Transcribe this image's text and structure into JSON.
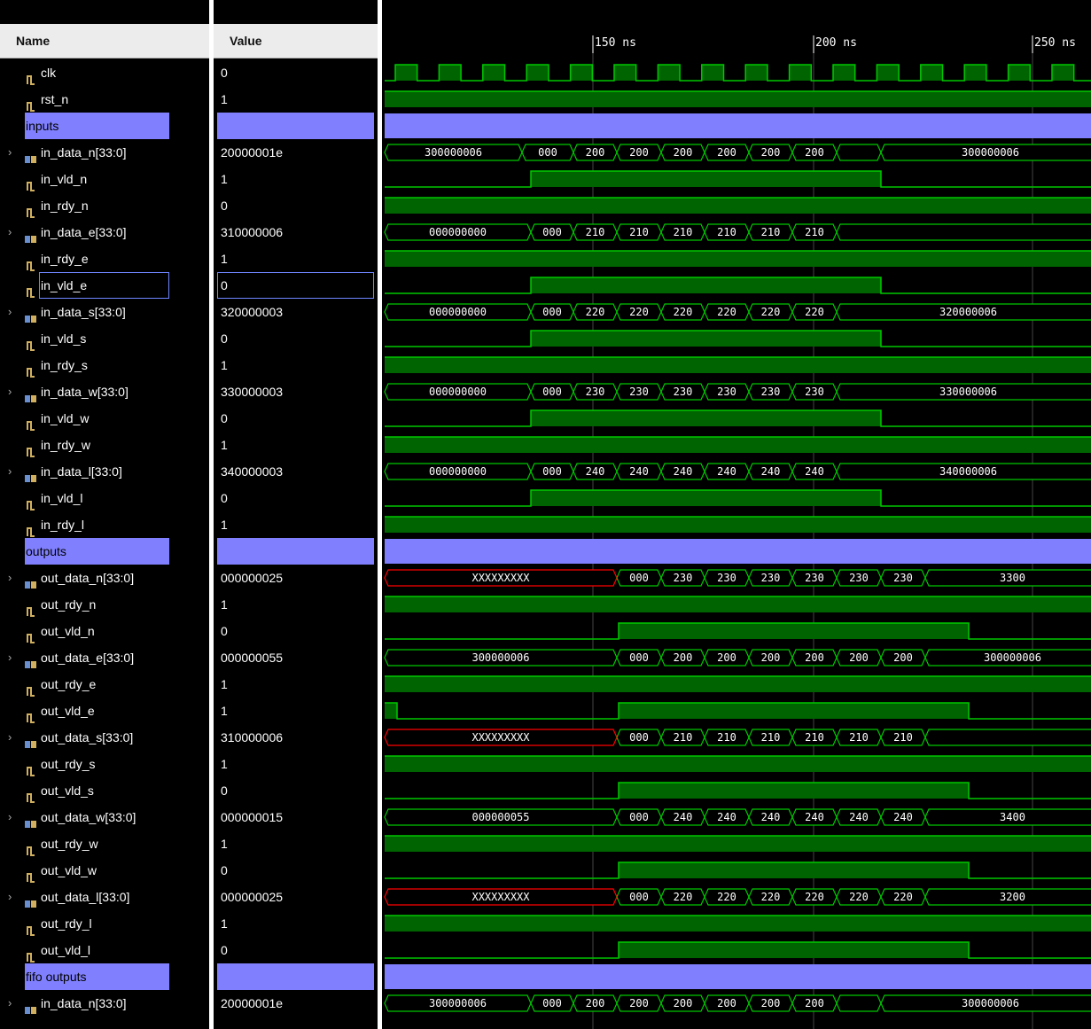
{
  "headers": {
    "name": "Name",
    "value": "Value"
  },
  "timeline": {
    "ticks": [
      "150 ns",
      "200 ns",
      "250 ns"
    ]
  },
  "colors": {
    "wave": "#00c800",
    "wave_fill": "#006400",
    "group": "#8080ff",
    "x_state": "#ff0000"
  },
  "signals": [
    {
      "type": "bit",
      "name": "clk",
      "value": "0"
    },
    {
      "type": "bit",
      "name": "rst_n",
      "value": "1"
    },
    {
      "type": "group",
      "name": "inputs",
      "value": ""
    },
    {
      "type": "bus",
      "name": "in_data_n[33:0]",
      "value": "20000001e"
    },
    {
      "type": "bit",
      "name": "in_vld_n",
      "value": "1"
    },
    {
      "type": "bit",
      "name": "in_rdy_n",
      "value": "0"
    },
    {
      "type": "bus",
      "name": "in_data_e[33:0]",
      "value": "310000006"
    },
    {
      "type": "bit",
      "name": "in_rdy_e",
      "value": "1"
    },
    {
      "type": "bit",
      "name": "in_vld_e",
      "value": "0",
      "selected": true
    },
    {
      "type": "bus",
      "name": "in_data_s[33:0]",
      "value": "320000003"
    },
    {
      "type": "bit",
      "name": "in_vld_s",
      "value": "0"
    },
    {
      "type": "bit",
      "name": "in_rdy_s",
      "value": "1"
    },
    {
      "type": "bus",
      "name": "in_data_w[33:0]",
      "value": "330000003"
    },
    {
      "type": "bit",
      "name": "in_vld_w",
      "value": "0"
    },
    {
      "type": "bit",
      "name": "in_rdy_w",
      "value": "1"
    },
    {
      "type": "bus",
      "name": "in_data_l[33:0]",
      "value": "340000003"
    },
    {
      "type": "bit",
      "name": "in_vld_l",
      "value": "0"
    },
    {
      "type": "bit",
      "name": "in_rdy_l",
      "value": "1"
    },
    {
      "type": "group",
      "name": "outputs",
      "value": ""
    },
    {
      "type": "bus",
      "name": "out_data_n[33:0]",
      "value": "000000025"
    },
    {
      "type": "bit",
      "name": "out_rdy_n",
      "value": "1"
    },
    {
      "type": "bit",
      "name": "out_vld_n",
      "value": "0"
    },
    {
      "type": "bus",
      "name": "out_data_e[33:0]",
      "value": "000000055"
    },
    {
      "type": "bit",
      "name": "out_rdy_e",
      "value": "1"
    },
    {
      "type": "bit",
      "name": "out_vld_e",
      "value": "1"
    },
    {
      "type": "bus",
      "name": "out_data_s[33:0]",
      "value": "310000006"
    },
    {
      "type": "bit",
      "name": "out_rdy_s",
      "value": "1"
    },
    {
      "type": "bit",
      "name": "out_vld_s",
      "value": "0"
    },
    {
      "type": "bus",
      "name": "out_data_w[33:0]",
      "value": "000000015"
    },
    {
      "type": "bit",
      "name": "out_rdy_w",
      "value": "1"
    },
    {
      "type": "bit",
      "name": "out_vld_w",
      "value": "0"
    },
    {
      "type": "bus",
      "name": "out_data_l[33:0]",
      "value": "000000025"
    },
    {
      "type": "bit",
      "name": "out_rdy_l",
      "value": "1"
    },
    {
      "type": "bit",
      "name": "out_vld_l",
      "value": "0"
    },
    {
      "type": "group",
      "name": "fifo outputs",
      "value": ""
    },
    {
      "type": "bus",
      "name": "in_data_n[33:0]",
      "value": "20000001e"
    }
  ],
  "waves": [
    {
      "kind": "clock"
    },
    {
      "kind": "bit",
      "v": [
        [
          0,
          1
        ]
      ]
    },
    {
      "kind": "group"
    },
    {
      "kind": "bus",
      "v": [
        [
          0,
          "300000006"
        ],
        [
          155,
          "000"
        ],
        [
          213,
          "200"
        ],
        [
          262,
          "200"
        ],
        [
          312,
          "200"
        ],
        [
          361,
          "200"
        ],
        [
          411,
          "200"
        ],
        [
          460,
          "200"
        ],
        [
          510,
          ""
        ],
        [
          560,
          "300000006"
        ]
      ]
    },
    {
      "kind": "bit",
      "v": [
        [
          0,
          0
        ],
        [
          165,
          1
        ],
        [
          560,
          0
        ]
      ]
    },
    {
      "kind": "bit",
      "v": [
        [
          0,
          1
        ]
      ]
    },
    {
      "kind": "bus",
      "v": [
        [
          0,
          "000000000"
        ],
        [
          165,
          "000"
        ],
        [
          213,
          "210"
        ],
        [
          262,
          "210"
        ],
        [
          312,
          "210"
        ],
        [
          361,
          "210"
        ],
        [
          411,
          "210"
        ],
        [
          460,
          "210"
        ],
        [
          510,
          ""
        ]
      ]
    },
    {
      "kind": "bit",
      "v": [
        [
          0,
          1
        ]
      ]
    },
    {
      "kind": "bit",
      "v": [
        [
          0,
          0
        ],
        [
          165,
          1
        ],
        [
          560,
          0
        ]
      ]
    },
    {
      "kind": "bus",
      "v": [
        [
          0,
          "000000000"
        ],
        [
          165,
          "000"
        ],
        [
          213,
          "220"
        ],
        [
          262,
          "220"
        ],
        [
          312,
          "220"
        ],
        [
          361,
          "220"
        ],
        [
          411,
          "220"
        ],
        [
          460,
          "220"
        ],
        [
          510,
          "320000006"
        ]
      ]
    },
    {
      "kind": "bit",
      "v": [
        [
          0,
          0
        ],
        [
          165,
          1
        ],
        [
          560,
          0
        ]
      ]
    },
    {
      "kind": "bit",
      "v": [
        [
          0,
          1
        ]
      ]
    },
    {
      "kind": "bus",
      "v": [
        [
          0,
          "000000000"
        ],
        [
          165,
          "000"
        ],
        [
          213,
          "230"
        ],
        [
          262,
          "230"
        ],
        [
          312,
          "230"
        ],
        [
          361,
          "230"
        ],
        [
          411,
          "230"
        ],
        [
          460,
          "230"
        ],
        [
          510,
          "330000006"
        ]
      ]
    },
    {
      "kind": "bit",
      "v": [
        [
          0,
          0
        ],
        [
          165,
          1
        ],
        [
          560,
          0
        ]
      ]
    },
    {
      "kind": "bit",
      "v": [
        [
          0,
          1
        ]
      ]
    },
    {
      "kind": "bus",
      "v": [
        [
          0,
          "000000000"
        ],
        [
          165,
          "000"
        ],
        [
          213,
          "240"
        ],
        [
          262,
          "240"
        ],
        [
          312,
          "240"
        ],
        [
          361,
          "240"
        ],
        [
          411,
          "240"
        ],
        [
          460,
          "240"
        ],
        [
          510,
          "340000006"
        ]
      ]
    },
    {
      "kind": "bit",
      "v": [
        [
          0,
          0
        ],
        [
          165,
          1
        ],
        [
          560,
          0
        ]
      ]
    },
    {
      "kind": "bit",
      "v": [
        [
          0,
          1
        ]
      ]
    },
    {
      "kind": "group"
    },
    {
      "kind": "bus",
      "v": [
        [
          0,
          "XXXXXXXXX",
          "x"
        ],
        [
          262,
          "000"
        ],
        [
          312,
          "230"
        ],
        [
          361,
          "230"
        ],
        [
          411,
          "230"
        ],
        [
          460,
          "230"
        ],
        [
          510,
          "230"
        ],
        [
          560,
          "230"
        ],
        [
          610,
          "3300"
        ]
      ]
    },
    {
      "kind": "bit",
      "v": [
        [
          0,
          1
        ]
      ]
    },
    {
      "kind": "bit",
      "v": [
        [
          0,
          0
        ],
        [
          264,
          1
        ],
        [
          659,
          0
        ]
      ]
    },
    {
      "kind": "bus",
      "v": [
        [
          0,
          "300000006"
        ],
        [
          262,
          "000"
        ],
        [
          312,
          "200"
        ],
        [
          361,
          "200"
        ],
        [
          411,
          "200"
        ],
        [
          460,
          "200"
        ],
        [
          510,
          "200"
        ],
        [
          560,
          "200"
        ],
        [
          610,
          "300000006"
        ]
      ]
    },
    {
      "kind": "bit",
      "v": [
        [
          0,
          1
        ]
      ]
    },
    {
      "kind": "bit",
      "v": [
        [
          0,
          1
        ],
        [
          14,
          0
        ],
        [
          264,
          1
        ],
        [
          659,
          0
        ]
      ]
    },
    {
      "kind": "bus",
      "v": [
        [
          0,
          "XXXXXXXXX",
          "x"
        ],
        [
          262,
          "000"
        ],
        [
          312,
          "210"
        ],
        [
          361,
          "210"
        ],
        [
          411,
          "210"
        ],
        [
          460,
          "210"
        ],
        [
          510,
          "210"
        ],
        [
          560,
          "210"
        ],
        [
          610,
          ""
        ]
      ]
    },
    {
      "kind": "bit",
      "v": [
        [
          0,
          1
        ]
      ]
    },
    {
      "kind": "bit",
      "v": [
        [
          0,
          0
        ],
        [
          264,
          1
        ],
        [
          659,
          0
        ]
      ]
    },
    {
      "kind": "bus",
      "v": [
        [
          0,
          "000000055"
        ],
        [
          262,
          "000"
        ],
        [
          312,
          "240"
        ],
        [
          361,
          "240"
        ],
        [
          411,
          "240"
        ],
        [
          460,
          "240"
        ],
        [
          510,
          "240"
        ],
        [
          560,
          "240"
        ],
        [
          610,
          "3400"
        ]
      ]
    },
    {
      "kind": "bit",
      "v": [
        [
          0,
          1
        ]
      ]
    },
    {
      "kind": "bit",
      "v": [
        [
          0,
          0
        ],
        [
          264,
          1
        ],
        [
          659,
          0
        ]
      ]
    },
    {
      "kind": "bus",
      "v": [
        [
          0,
          "XXXXXXXXX",
          "x"
        ],
        [
          262,
          "000"
        ],
        [
          312,
          "220"
        ],
        [
          361,
          "220"
        ],
        [
          411,
          "220"
        ],
        [
          460,
          "220"
        ],
        [
          510,
          "220"
        ],
        [
          560,
          "220"
        ],
        [
          610,
          "3200"
        ]
      ]
    },
    {
      "kind": "bit",
      "v": [
        [
          0,
          1
        ]
      ]
    },
    {
      "kind": "bit",
      "v": [
        [
          0,
          0
        ],
        [
          264,
          1
        ],
        [
          659,
          0
        ]
      ]
    },
    {
      "kind": "group"
    },
    {
      "kind": "bus",
      "v": [
        [
          0,
          "300000006"
        ],
        [
          165,
          "000"
        ],
        [
          213,
          "200"
        ],
        [
          262,
          "200"
        ],
        [
          312,
          "200"
        ],
        [
          361,
          "200"
        ],
        [
          411,
          "200"
        ],
        [
          460,
          "200"
        ],
        [
          510,
          ""
        ],
        [
          560,
          "300000006"
        ]
      ]
    }
  ]
}
